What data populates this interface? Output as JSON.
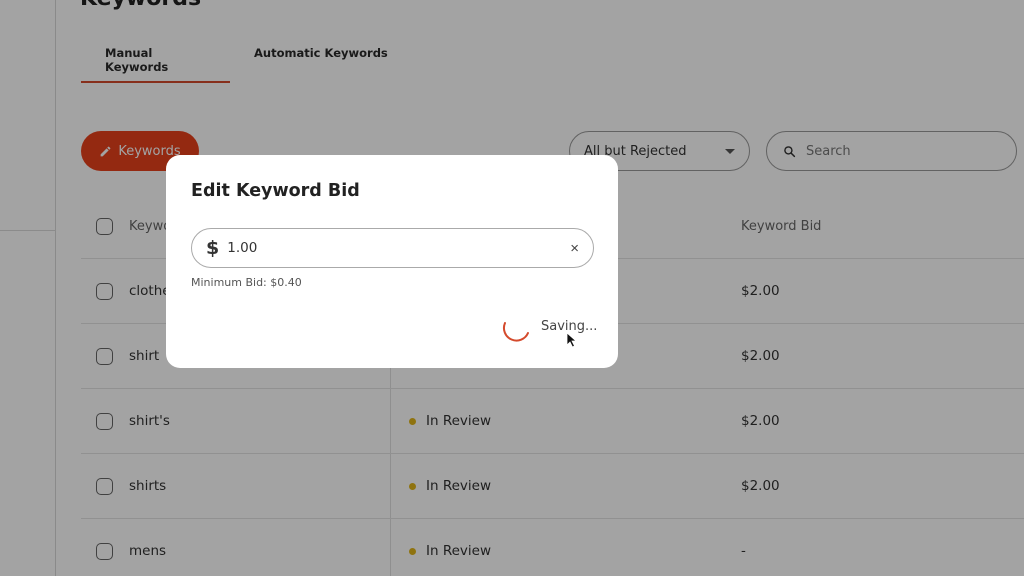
{
  "page": {
    "title": "Keywords",
    "tabs": [
      {
        "label": "Manual Keywords",
        "active": true
      },
      {
        "label": "Automatic Keywords",
        "active": false
      }
    ],
    "accent_color": "#e8401c"
  },
  "toolbar": {
    "keywords_button_label": "Keywords",
    "keywords_button_icon": "pencil-icon",
    "filter_selected": "All but Rejected",
    "search_placeholder": "Search"
  },
  "table": {
    "headers": {
      "keyword": "Keyword",
      "status": "",
      "bid": "Keyword Bid"
    },
    "rows": [
      {
        "keyword": "clothes",
        "status": "",
        "bid": "$2.00"
      },
      {
        "keyword": "shirt",
        "status": "",
        "bid": "$2.00"
      },
      {
        "keyword": "shirt's",
        "status": "In Review",
        "bid": "$2.00"
      },
      {
        "keyword": "shirts",
        "status": "In Review",
        "bid": "$2.00"
      },
      {
        "keyword": "mens",
        "status": "In Review",
        "bid": "-"
      }
    ],
    "status_color": "#e0b418"
  },
  "modal": {
    "title": "Edit Keyword Bid",
    "currency_symbol": "$",
    "bid_value": "1.00",
    "clear_icon": "×",
    "helper_text": "Minimum Bid: $0.40",
    "status_text": "Saving..."
  }
}
